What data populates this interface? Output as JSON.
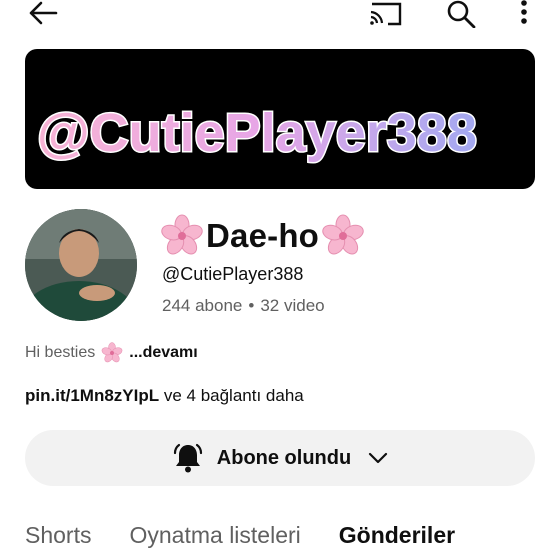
{
  "topbar": {
    "icons": [
      "back-arrow-icon",
      "cast-icon",
      "search-icon",
      "more-vert-icon"
    ]
  },
  "banner": {
    "text": "@CutiePlayer388"
  },
  "channel": {
    "name": "Dae-ho",
    "handle": "@CutiePlayer388",
    "subscribers": "244 abone",
    "separator": "•",
    "videos": "32 video"
  },
  "description": {
    "text": "Hi besties",
    "more": "...devamı"
  },
  "links": {
    "url": "pin.it/1Mn8zYIpL",
    "extra": " ve 4 bağlantı daha"
  },
  "subscribe": {
    "label": "Abone olundu"
  },
  "tabs": [
    {
      "label": "Shorts",
      "active": false
    },
    {
      "label": "Oynatma listeleri",
      "active": false
    },
    {
      "label": "Gönderiler",
      "active": true
    }
  ],
  "colors": {
    "banner_bg": "#000000",
    "button_bg": "#f2f2f2",
    "secondary_text": "#606060",
    "flower_pink": "#f4a6c4"
  }
}
